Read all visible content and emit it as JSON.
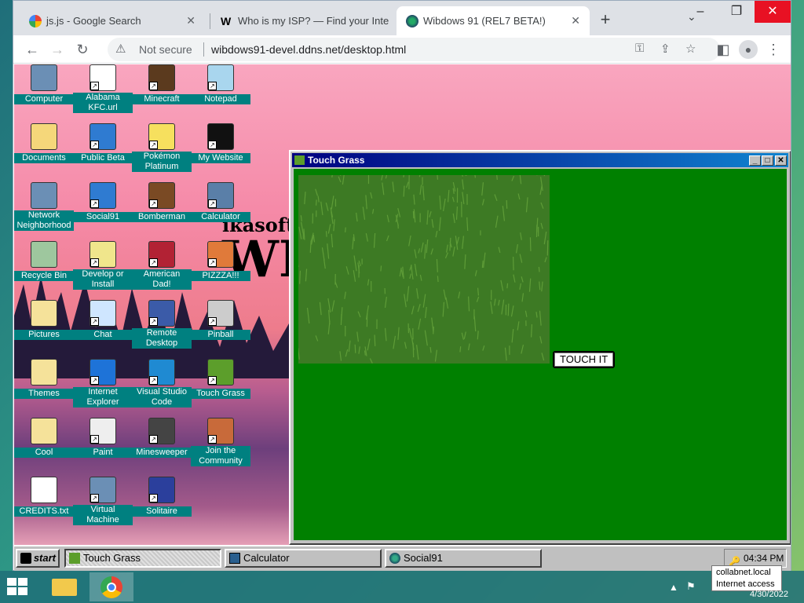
{
  "browser": {
    "tabs": [
      {
        "title": "js.js - Google Search",
        "icon": "google-icon"
      },
      {
        "title": "Who is my ISP? — Find your Inte",
        "icon": "w-logo-icon"
      },
      {
        "title": "Wibdows 91 (REL7 BETA!)",
        "icon": "wibdows-icon"
      }
    ],
    "new_tab": "+",
    "tab_search": "⌄",
    "security": "Not secure",
    "url": "wibdows91-devel.ddns.net/desktop.html"
  },
  "wallpaper": {
    "logo_line1": "ikasoft",
    "logo_line2": "WI"
  },
  "desktop_icons": [
    {
      "label": "Computer",
      "icon": "computer-icon",
      "shortcut": false
    },
    {
      "label": "Alabama KFC.url",
      "icon": "internet-shortcut-icon",
      "shortcut": true
    },
    {
      "label": "Minecraft",
      "icon": "minecraft-icon",
      "shortcut": true
    },
    {
      "label": "Notepad",
      "icon": "notepad-icon",
      "shortcut": true
    },
    {
      "label": "Documents",
      "icon": "folder-open-icon",
      "shortcut": false
    },
    {
      "label": "Public Beta",
      "icon": "globe-icon",
      "shortcut": true
    },
    {
      "label": "Pokémon Platinum",
      "icon": "pikachu-icon",
      "shortcut": true
    },
    {
      "label": "My Website",
      "icon": "github-icon",
      "shortcut": true
    },
    {
      "label": "Network Neighborhood",
      "icon": "network-icon",
      "shortcut": false
    },
    {
      "label": "Social91",
      "icon": "globe-icon",
      "shortcut": true
    },
    {
      "label": "Bomberman",
      "icon": "bomberman-icon",
      "shortcut": true
    },
    {
      "label": "Calculator",
      "icon": "calculator-icon",
      "shortcut": true
    },
    {
      "label": "Recycle Bin",
      "icon": "recycle-bin-icon",
      "shortcut": false
    },
    {
      "label": "Develop or Install",
      "icon": "help-icon",
      "shortcut": true
    },
    {
      "label": "American Dad!",
      "icon": "flag-icon",
      "shortcut": true
    },
    {
      "label": "PIZZZA!!!",
      "icon": "pizza-icon",
      "shortcut": true
    },
    {
      "label": "Pictures",
      "icon": "folder-icon",
      "shortcut": false
    },
    {
      "label": "Chat",
      "icon": "chat-icon",
      "shortcut": true
    },
    {
      "label": "Remote Desktop",
      "icon": "remote-desktop-icon",
      "shortcut": true
    },
    {
      "label": "Pinball",
      "icon": "pinball-icon",
      "shortcut": true
    },
    {
      "label": "Themes",
      "icon": "folder-icon",
      "shortcut": false
    },
    {
      "label": "Internet Explorer",
      "icon": "ie-icon",
      "shortcut": true
    },
    {
      "label": "Visual Studio Code",
      "icon": "vscode-icon",
      "shortcut": true
    },
    {
      "label": "Touch Grass",
      "icon": "grass-icon",
      "shortcut": true
    },
    {
      "label": "Cool",
      "icon": "folder-icon",
      "shortcut": false
    },
    {
      "label": "Paint",
      "icon": "paint-icon",
      "shortcut": true
    },
    {
      "label": "Minesweeper",
      "icon": "mine-icon",
      "shortcut": true
    },
    {
      "label": "Join the Community",
      "icon": "community-icon",
      "shortcut": true
    },
    {
      "label": "CREDITS.txt",
      "icon": "text-file-icon",
      "shortcut": false
    },
    {
      "label": "Virtual Machine",
      "icon": "computer-icon",
      "shortcut": true
    },
    {
      "label": "Solitaire",
      "icon": "cards-icon",
      "shortcut": true
    }
  ],
  "app_window": {
    "title": "Touch Grass",
    "minimize": "_",
    "maximize": "□",
    "close": "✕",
    "button_label": "TOUCH IT"
  },
  "taskbar": {
    "start_label": "start",
    "items": [
      {
        "label": "Touch Grass",
        "active": true
      },
      {
        "label": "Calculator",
        "active": false
      },
      {
        "label": "Social91",
        "active": false
      }
    ],
    "clock": "04:34 PM"
  },
  "host": {
    "tooltip_line1": "collabnet.local",
    "tooltip_line2": "Internet access",
    "date": "4/30/2022"
  },
  "colors": {
    "desktop_label_bg": "#008080",
    "app_body": "#008000",
    "titlebar": "#000080"
  }
}
